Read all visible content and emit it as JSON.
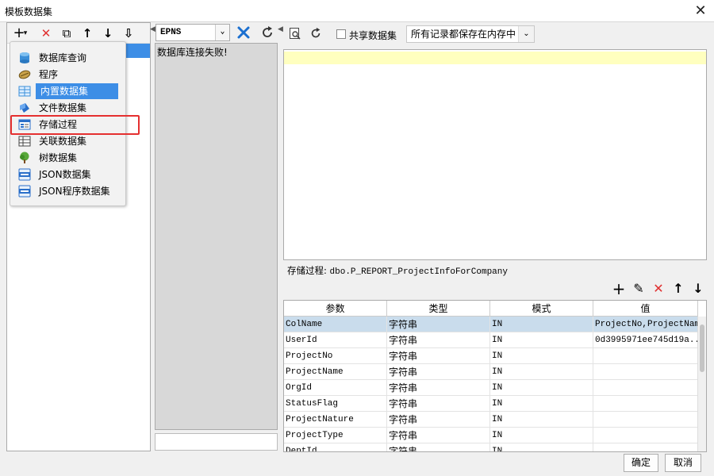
{
  "window": {
    "title": "模板数据集",
    "close_glyph": "✕"
  },
  "left_toolbar": {
    "add": "+",
    "add_caret": "▾",
    "delete": "✕",
    "copy": "⧉",
    "up": "↑",
    "down": "↓",
    "sort": "⇩"
  },
  "add_menu": {
    "items": [
      {
        "label": "数据库查询",
        "icon": "database-icon"
      },
      {
        "label": "程序",
        "icon": "program-icon"
      },
      {
        "label": "内置数据集",
        "icon": "builtin-dataset-icon",
        "selected": true
      },
      {
        "label": "文件数据集",
        "icon": "file-dataset-icon"
      },
      {
        "label": "存储过程",
        "icon": "stored-procedure-icon",
        "highlighted": true
      },
      {
        "label": "关联数据集",
        "icon": "relation-dataset-icon"
      },
      {
        "label": "树数据集",
        "icon": "tree-dataset-icon"
      },
      {
        "label": "JSON数据集",
        "icon": "json-icon"
      },
      {
        "label": "JSON程序数据集",
        "icon": "json-program-icon"
      }
    ]
  },
  "middle": {
    "db_select": "EPNS",
    "db_select_caret": "⌄",
    "message": "数据库连接失败!"
  },
  "right_toolbar": {
    "share_label": "共享数据集",
    "share_checked": false,
    "storage_select": "所有记录都保存在内存中",
    "storage_select_caret": "⌄"
  },
  "procedure": {
    "label": "存储过程:",
    "name": "dbo.P_REPORT_ProjectInfoForCompany"
  },
  "param_toolbar": {
    "add": "+",
    "edit": "✎",
    "delete": "✕",
    "up": "↑",
    "down": "↓"
  },
  "params": {
    "headers": [
      "参数",
      "类型",
      "模式",
      "值"
    ],
    "rows": [
      {
        "name": "ColName",
        "type": "字符串",
        "mode": "IN",
        "value": "ProjectNo,ProjectName",
        "selected": true
      },
      {
        "name": "UserId",
        "type": "字符串",
        "mode": "IN",
        "value": "0d3995971ee745d19a..."
      },
      {
        "name": "ProjectNo",
        "type": "字符串",
        "mode": "IN",
        "value": ""
      },
      {
        "name": "ProjectName",
        "type": "字符串",
        "mode": "IN",
        "value": ""
      },
      {
        "name": "OrgId",
        "type": "字符串",
        "mode": "IN",
        "value": ""
      },
      {
        "name": "StatusFlag",
        "type": "字符串",
        "mode": "IN",
        "value": ""
      },
      {
        "name": "ProjectNature",
        "type": "字符串",
        "mode": "IN",
        "value": ""
      },
      {
        "name": "ProjectType",
        "type": "字符串",
        "mode": "IN",
        "value": ""
      },
      {
        "name": "DeptId",
        "type": "字符串",
        "mode": "IN",
        "value": ""
      }
    ]
  },
  "footer": {
    "ok": "确定",
    "cancel": "取消"
  },
  "colors": {
    "selection": "#3d8ee6",
    "row_selected": "#c9dcec",
    "highlight_border": "#e53030",
    "editor_line": "#ffffbf"
  }
}
